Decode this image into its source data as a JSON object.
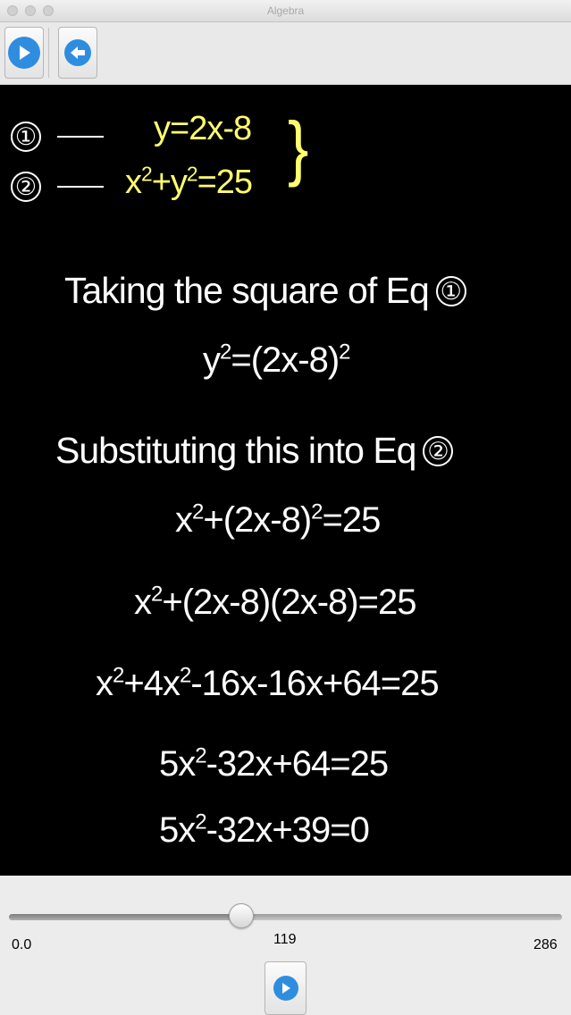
{
  "window": {
    "title": "Algebra"
  },
  "system": {
    "eq1_marker": "①",
    "eq2_marker": "②",
    "eq1": "y=2x-8",
    "eq2_x": "x",
    "eq2_exp1": "2",
    "eq2_mid": "+y",
    "eq2_exp2": "2",
    "eq2_tail": "=25",
    "brace": "}"
  },
  "steps": {
    "heading1": "Taking the square of Eq",
    "heading1_ref": "①",
    "line1": {
      "a": "y",
      "b": "2",
      "c": "=(2x-8)",
      "d": "2"
    },
    "heading2": "Substituting this into Eq",
    "heading2_ref": "②",
    "line2": {
      "a": "x",
      "b": "2",
      "c": "+(2x-8)",
      "d": "2",
      "e": "=25"
    },
    "line3": {
      "a": "x",
      "b": "2",
      "c": "+(2x-8)(2x-8)=25"
    },
    "line4": {
      "a": "x",
      "b": "2",
      "c": "+4x",
      "d": "2",
      "e": "-16x-16x+64=25"
    },
    "line5": {
      "a": "5x",
      "b": "2",
      "c": "-32x+64=25"
    },
    "line6": {
      "a": "5x",
      "b": "2",
      "c": "-32x+39=0"
    }
  },
  "slider": {
    "min_label": "0.0",
    "current_label": "119",
    "max_label": "286",
    "min": 0,
    "max": 286,
    "value": 119
  },
  "colors": {
    "equation_yellow": "#ffff6e",
    "accent_blue": "#2f8de0",
    "board": "#000000"
  }
}
